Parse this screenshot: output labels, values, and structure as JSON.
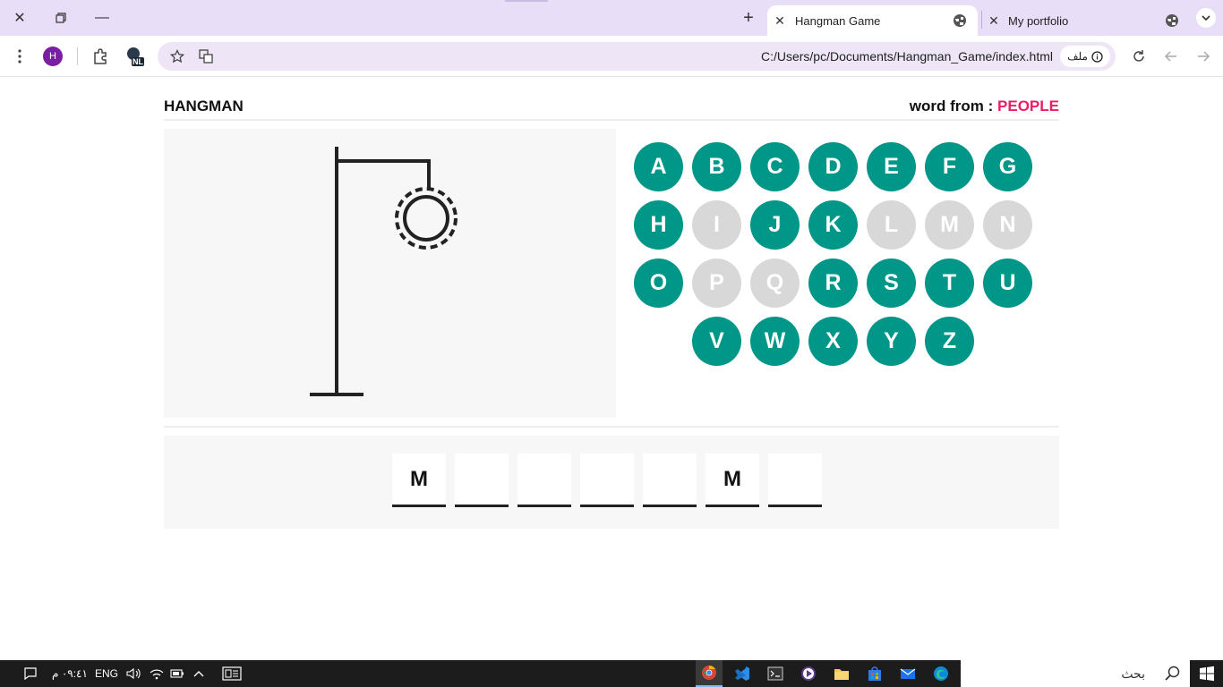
{
  "browser": {
    "tabs": [
      {
        "title": "Hangman Game",
        "active": true
      },
      {
        "title": "My portfolio",
        "active": false
      }
    ],
    "profile_initial": "H",
    "extension_badge": "NL",
    "url": "C:/Users/pc/Documents/Hangman_Game/index.html",
    "site_chip": "ملف"
  },
  "game": {
    "title": "HANGMAN",
    "category_label": "word from :",
    "category_value": "PEOPLE",
    "letters": [
      {
        "char": "A",
        "used": false
      },
      {
        "char": "B",
        "used": false
      },
      {
        "char": "C",
        "used": false
      },
      {
        "char": "D",
        "used": false
      },
      {
        "char": "E",
        "used": false
      },
      {
        "char": "F",
        "used": false
      },
      {
        "char": "G",
        "used": false
      },
      {
        "char": "H",
        "used": false
      },
      {
        "char": "I",
        "used": true
      },
      {
        "char": "J",
        "used": false
      },
      {
        "char": "K",
        "used": false
      },
      {
        "char": "L",
        "used": true
      },
      {
        "char": "M",
        "used": true
      },
      {
        "char": "N",
        "used": true
      },
      {
        "char": "O",
        "used": false
      },
      {
        "char": "P",
        "used": true
      },
      {
        "char": "Q",
        "used": true
      },
      {
        "char": "R",
        "used": false
      },
      {
        "char": "S",
        "used": false
      },
      {
        "char": "T",
        "used": false
      },
      {
        "char": "U",
        "used": false
      },
      {
        "char": "V",
        "used": false
      },
      {
        "char": "W",
        "used": false
      },
      {
        "char": "X",
        "used": false
      },
      {
        "char": "Y",
        "used": false
      },
      {
        "char": "Z",
        "used": false
      }
    ],
    "guess_slots": [
      "M",
      "",
      "",
      "",
      "",
      "M",
      ""
    ]
  },
  "colors": {
    "accent": "#009688",
    "used_letter": "#d8d8d8",
    "category": "#e91e63"
  },
  "taskbar": {
    "time": "٠٩:٤١ م",
    "language": "ENG",
    "search_placeholder": "بحث"
  }
}
